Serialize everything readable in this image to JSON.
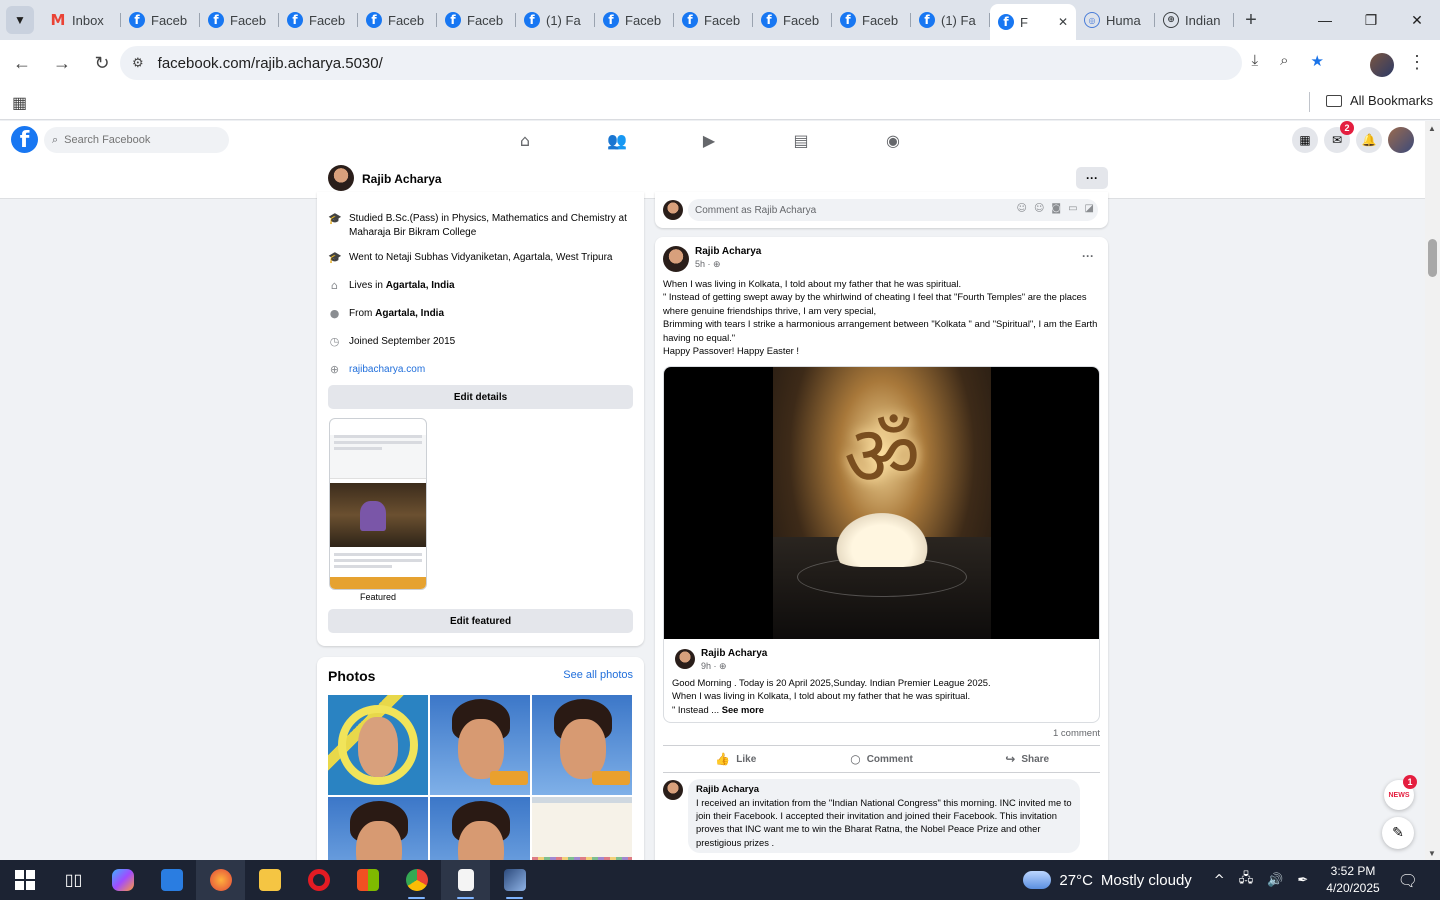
{
  "browser": {
    "tabs": [
      {
        "label": "Inbox",
        "icon": "gmail-icon"
      },
      {
        "label": "Faceb",
        "icon": "facebook-icon"
      },
      {
        "label": "Faceb",
        "icon": "facebook-icon"
      },
      {
        "label": "Faceb",
        "icon": "facebook-icon"
      },
      {
        "label": "Faceb",
        "icon": "facebook-icon"
      },
      {
        "label": "Faceb",
        "icon": "facebook-icon"
      },
      {
        "label": "(1) Fa",
        "icon": "facebook-icon"
      },
      {
        "label": "Faceb",
        "icon": "facebook-icon"
      },
      {
        "label": "Faceb",
        "icon": "facebook-icon"
      },
      {
        "label": "Faceb",
        "icon": "facebook-icon"
      },
      {
        "label": "Faceb",
        "icon": "facebook-icon"
      },
      {
        "label": "(1) Fa",
        "icon": "facebook-icon"
      },
      {
        "label": "F",
        "icon": "facebook-icon",
        "active": true
      },
      {
        "label": "Huma",
        "icon": "web-icon"
      },
      {
        "label": "Indian",
        "icon": "globe-icon"
      }
    ],
    "url": "facebook.com/rajib.acharya.5030/",
    "bookmarks_label": "All Bookmarks"
  },
  "facebook": {
    "search_placeholder": "Search Facebook",
    "messenger_badge": "2",
    "profile_name": "Rajib Acharya",
    "intro": {
      "items": [
        {
          "icon": "graduation-cap-icon",
          "text": "Studied B.Sc.(Pass) in Physics, Mathematics and Chemistry at Maharaja Bir Bikram College"
        },
        {
          "icon": "graduation-cap-icon",
          "text": "Went to Netaji Subhas Vidyaniketan, Agartala, West Tripura"
        },
        {
          "icon": "home-icon",
          "prefix": "Lives in ",
          "bold": "Agartala, India"
        },
        {
          "icon": "location-pin-icon",
          "prefix": "From ",
          "bold": "Agartala, India"
        },
        {
          "icon": "clock-icon",
          "text": "Joined September 2015"
        },
        {
          "icon": "globe-icon",
          "link": "rajibacharya.com"
        }
      ],
      "edit_details": "Edit details",
      "featured_label": "Featured",
      "edit_featured": "Edit featured"
    },
    "photos": {
      "title": "Photos",
      "see_all": "See all photos"
    },
    "comment_placeholder": "Comment as Rajib Acharya",
    "post": {
      "author": "Rajib Acharya",
      "time": "5h · ",
      "text_lines": [
        "When I was living in Kolkata, I told about my father that he was spiritual.",
        "\" Instead of getting swept away by the whirlwind of cheating I feel that \"Fourth Temples\" are the places where genuine friendships thrive, I am very special,",
        "Brimming with tears I strike a harmonious arrangement between \"Kolkata \" and \"Spiritual\", I am the Earth having no equal.\"",
        "Happy Passover! Happy Easter !"
      ],
      "shared": {
        "author": "Rajib Acharya",
        "time": "9h · ",
        "line1": "Good Morning . Today is 20 April 2025,Sunday. Indian Premier League 2025.",
        "line2": "When I was living in Kolkata, I told about my father that he was spiritual.",
        "line3": "\" Instead ...",
        "see_more": "See more"
      },
      "comment_count": "1 comment",
      "actions": {
        "like": "Like",
        "comment": "Comment",
        "share": "Share"
      },
      "comment": {
        "author": "Rajib Acharya",
        "text": "I received an invitation from the \"Indian National Congress\" this morning. INC invited me to join their Facebook. I accepted their invitation and joined their Facebook. This invitation proves that INC want me to win the Bharat Ratna, the Nobel Peace Prize and other prestigious prizes ."
      }
    },
    "chat_badge": "1"
  },
  "taskbar": {
    "weather_temp": "27°C",
    "weather_text": "Mostly cloudy",
    "time": "3:52 PM",
    "date": "4/20/2025"
  }
}
